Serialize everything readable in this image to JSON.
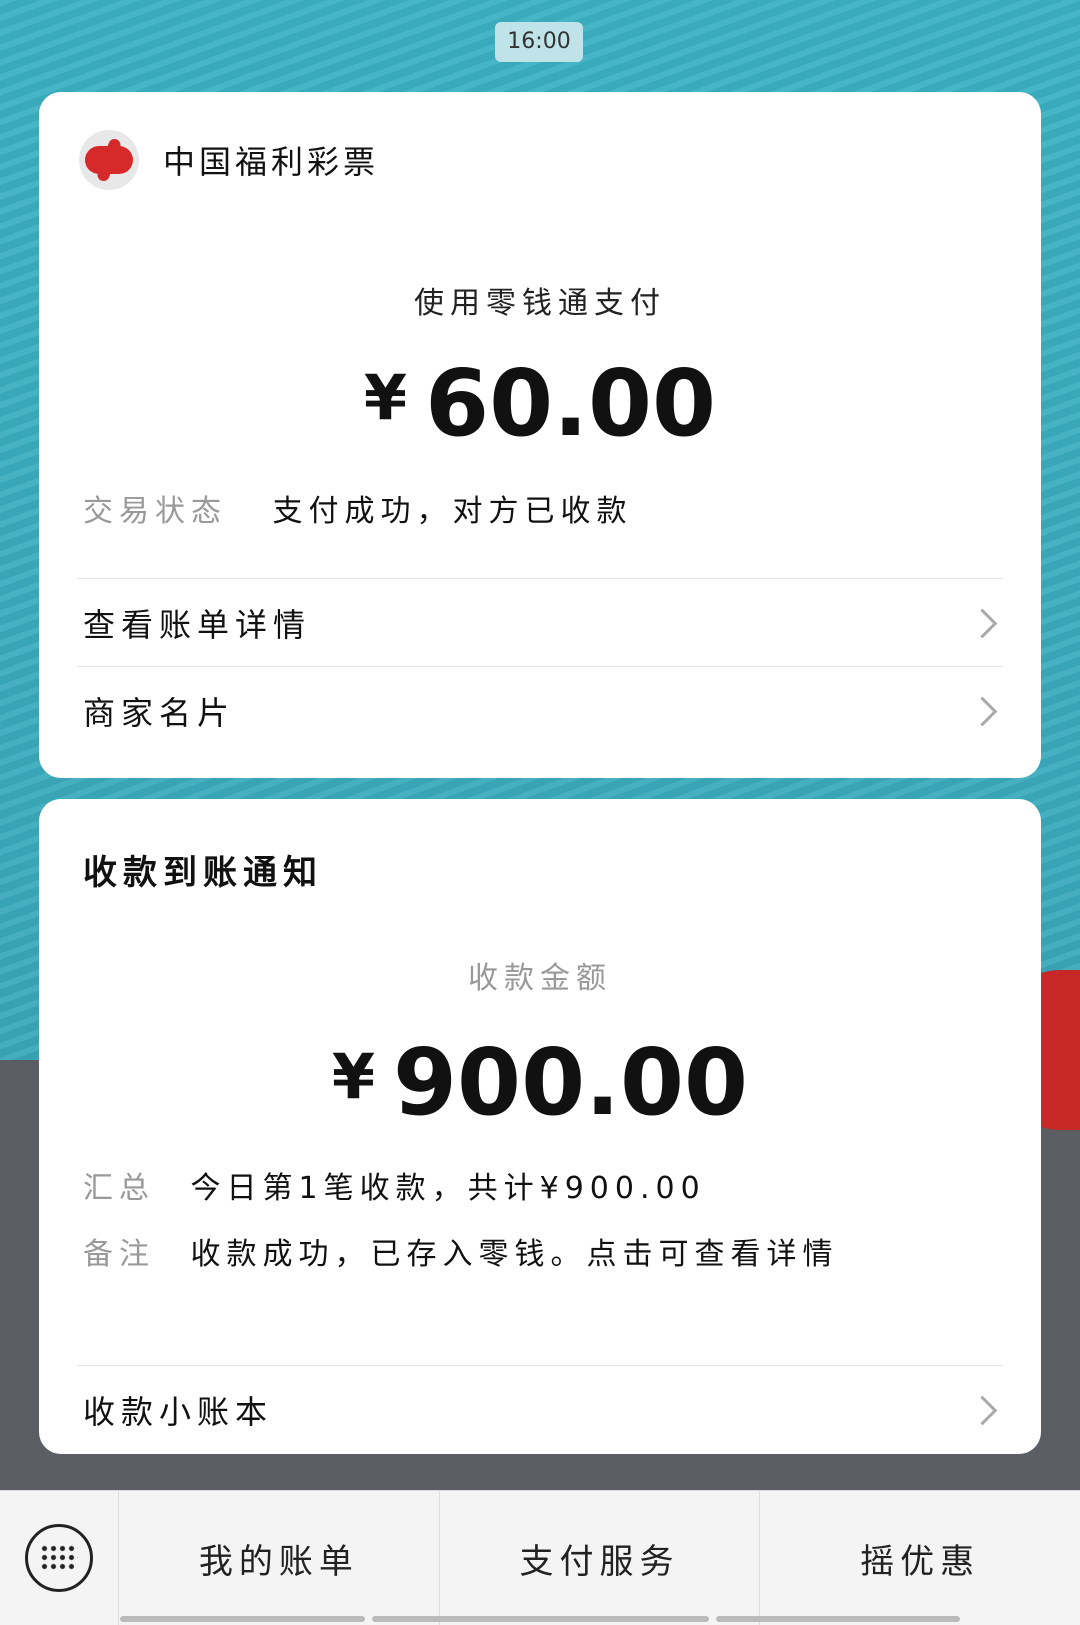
{
  "status": {
    "time": "16:00"
  },
  "payment_card": {
    "merchant_name": "中国福利彩票",
    "method_label": "使用零钱通支付",
    "currency_symbol": "¥",
    "amount": "60.00",
    "status_key": "交易状态",
    "status_value": "支付成功，对方已收款",
    "links": [
      {
        "label": "查看账单详情"
      },
      {
        "label": "商家名片"
      }
    ]
  },
  "receipt_card": {
    "title": "收款到账通知",
    "amount_label": "收款金额",
    "currency_symbol": "¥",
    "amount": "900.00",
    "summary_key": "汇总",
    "summary_value": "今日第1笔收款，共计¥900.00",
    "note_key": "备注",
    "note_value": "收款成功，已存入零钱。点击可查看详情",
    "link_label": "收款小账本"
  },
  "bottom_bar": {
    "keyboard_icon": "keyboard-icon",
    "tabs": [
      {
        "label": "我的账单"
      },
      {
        "label": "支付服务"
      },
      {
        "label": "摇优惠"
      }
    ]
  }
}
